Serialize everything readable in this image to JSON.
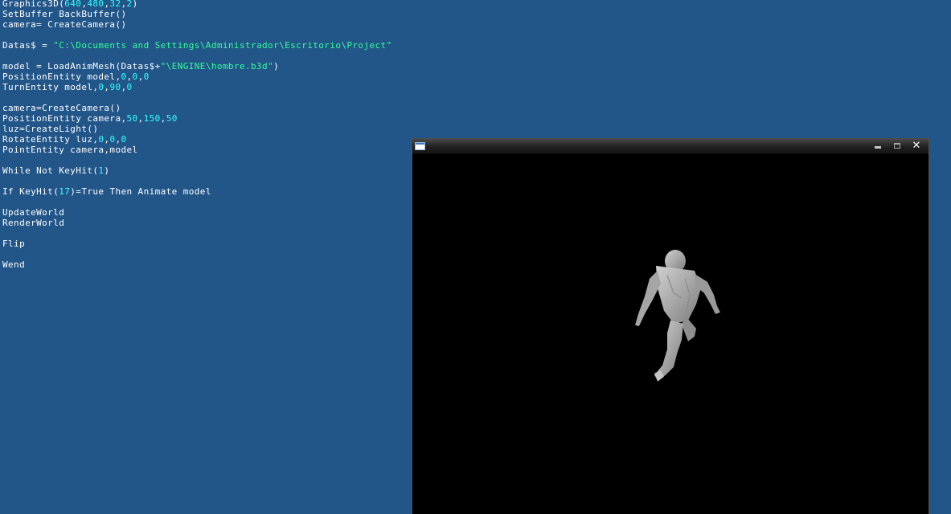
{
  "editor": {
    "lines": [
      [
        {
          "t": "Graphics3D(",
          "c": "plain"
        },
        {
          "t": "640",
          "c": "num"
        },
        {
          "t": ",",
          "c": "plain"
        },
        {
          "t": "480",
          "c": "num"
        },
        {
          "t": ",",
          "c": "plain"
        },
        {
          "t": "32",
          "c": "num"
        },
        {
          "t": ",",
          "c": "plain"
        },
        {
          "t": "2",
          "c": "num"
        },
        {
          "t": ")",
          "c": "plain"
        }
      ],
      [
        {
          "t": "SetBuffer BackBuffer()",
          "c": "plain"
        }
      ],
      [
        {
          "t": "camera= CreateCamera()",
          "c": "plain"
        }
      ],
      [],
      [
        {
          "t": "Datas$ = ",
          "c": "plain"
        },
        {
          "t": "\"C:\\Documents and Settings\\Administrador\\Escritorio\\Project\"",
          "c": "str"
        }
      ],
      [],
      [
        {
          "t": "model = LoadAnimMesh(Datas$+",
          "c": "plain"
        },
        {
          "t": "\"\\ENGINE\\hombre.b3d\"",
          "c": "str"
        },
        {
          "t": ")",
          "c": "plain"
        }
      ],
      [
        {
          "t": "PositionEntity model,",
          "c": "plain"
        },
        {
          "t": "0",
          "c": "num"
        },
        {
          "t": ",",
          "c": "plain"
        },
        {
          "t": "0",
          "c": "num"
        },
        {
          "t": ",",
          "c": "plain"
        },
        {
          "t": "0",
          "c": "num"
        }
      ],
      [
        {
          "t": "TurnEntity model,",
          "c": "plain"
        },
        {
          "t": "0",
          "c": "num"
        },
        {
          "t": ",",
          "c": "plain"
        },
        {
          "t": "90",
          "c": "num"
        },
        {
          "t": ",",
          "c": "plain"
        },
        {
          "t": "0",
          "c": "num"
        }
      ],
      [],
      [
        {
          "t": "camera=CreateCamera()",
          "c": "plain"
        }
      ],
      [
        {
          "t": "PositionEntity camera,",
          "c": "plain"
        },
        {
          "t": "50",
          "c": "num"
        },
        {
          "t": ",",
          "c": "plain"
        },
        {
          "t": "150",
          "c": "num"
        },
        {
          "t": ",",
          "c": "plain"
        },
        {
          "t": "50",
          "c": "num"
        }
      ],
      [
        {
          "t": "luz=CreateLight()",
          "c": "plain"
        }
      ],
      [
        {
          "t": "RotateEntity luz,",
          "c": "plain"
        },
        {
          "t": "0",
          "c": "num"
        },
        {
          "t": ",",
          "c": "plain"
        },
        {
          "t": "0",
          "c": "num"
        },
        {
          "t": ",",
          "c": "plain"
        },
        {
          "t": "0",
          "c": "num"
        }
      ],
      [
        {
          "t": "PointEntity camera,model",
          "c": "plain"
        }
      ],
      [],
      [
        {
          "t": "While Not KeyHit(",
          "c": "plain"
        },
        {
          "t": "1",
          "c": "num"
        },
        {
          "t": ")",
          "c": "plain"
        }
      ],
      [],
      [
        {
          "t": "If KeyHit(",
          "c": "plain"
        },
        {
          "t": "17",
          "c": "num"
        },
        {
          "t": ")=True Then Animate model",
          "c": "plain"
        }
      ],
      [],
      [
        {
          "t": "UpdateWorld",
          "c": "plain"
        }
      ],
      [
        {
          "t": "RenderWorld",
          "c": "plain"
        }
      ],
      [],
      [
        {
          "t": "Flip",
          "c": "plain"
        }
      ],
      [],
      [
        {
          "t": "Wend",
          "c": "plain"
        }
      ]
    ]
  },
  "preview_window": {
    "icons": {
      "app": "window-app-icon",
      "minimize": "minimize-icon",
      "maximize": "maximize-icon",
      "close": "close-icon"
    },
    "close_glyph": "✕"
  },
  "colors": {
    "editor_background": "#225588",
    "code_text": "#ffffff",
    "number_literal": "#33ffff",
    "string_literal": "#33ff99",
    "viewport_background": "#000000",
    "model_shade": "#b0b0b0"
  }
}
